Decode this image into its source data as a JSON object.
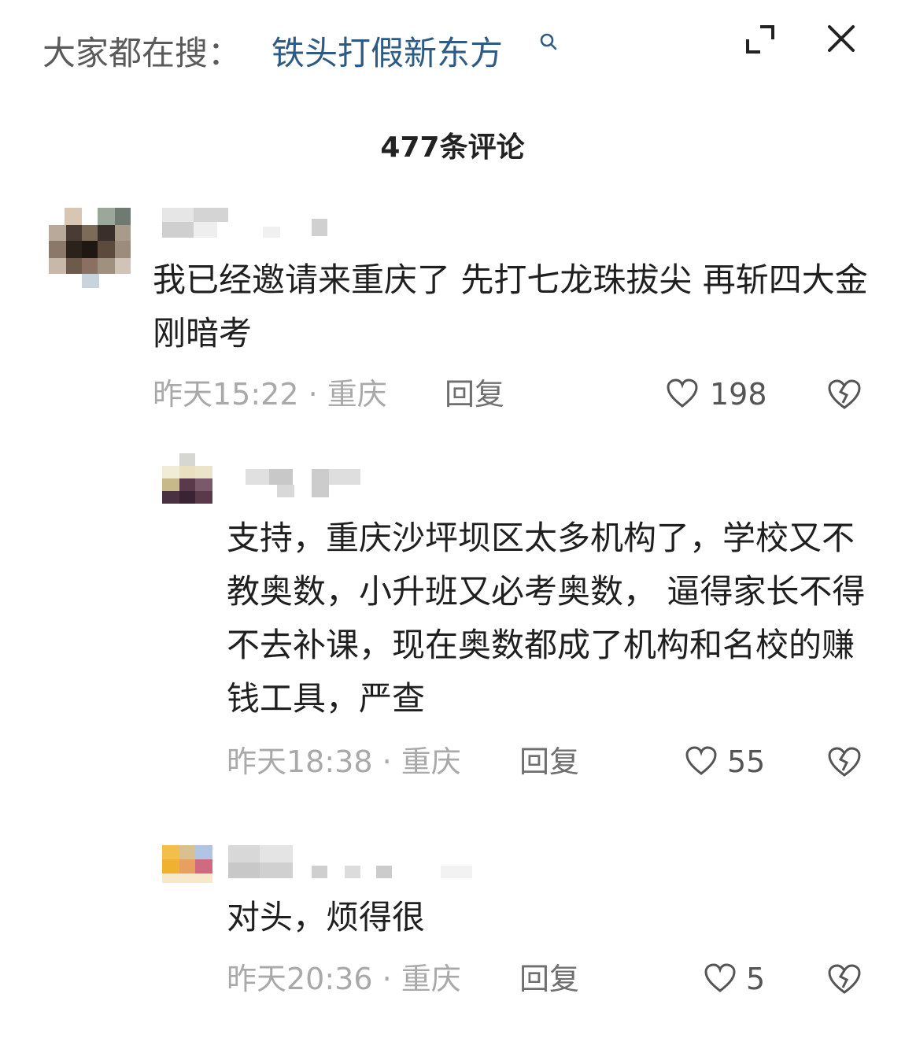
{
  "header": {
    "search_prefix": "大家都在搜：",
    "search_term": "铁头打假新东方",
    "icons": {
      "search": "search-icon",
      "expand": "expand-icon",
      "close": "close-icon"
    }
  },
  "comment_count": "477条评论",
  "comments": [
    {
      "text": "我已经邀请来重庆了 先打七龙珠拔尖 再斩四大金刚暗考",
      "time_location": "昨天15:22 · 重庆",
      "reply_label": "回复",
      "likes": "198"
    },
    {
      "text": "支持，重庆沙坪坝区太多机构了，学校又不教奥数，小升班又必考奥数， 逼得家长不得不去补课，现在奥数都成了机构和名校的赚钱工具，严查",
      "time_location": "昨天18:38 · 重庆",
      "reply_label": "回复",
      "likes": "55"
    },
    {
      "text": "对头，烦得很",
      "time_location": "昨天20:36 · 重庆",
      "reply_label": "回复",
      "likes": "5"
    }
  ],
  "colors": {
    "search_term": "#2e5b86",
    "meta_gray": "#a9a9a9",
    "text": "#1f1f1f"
  }
}
